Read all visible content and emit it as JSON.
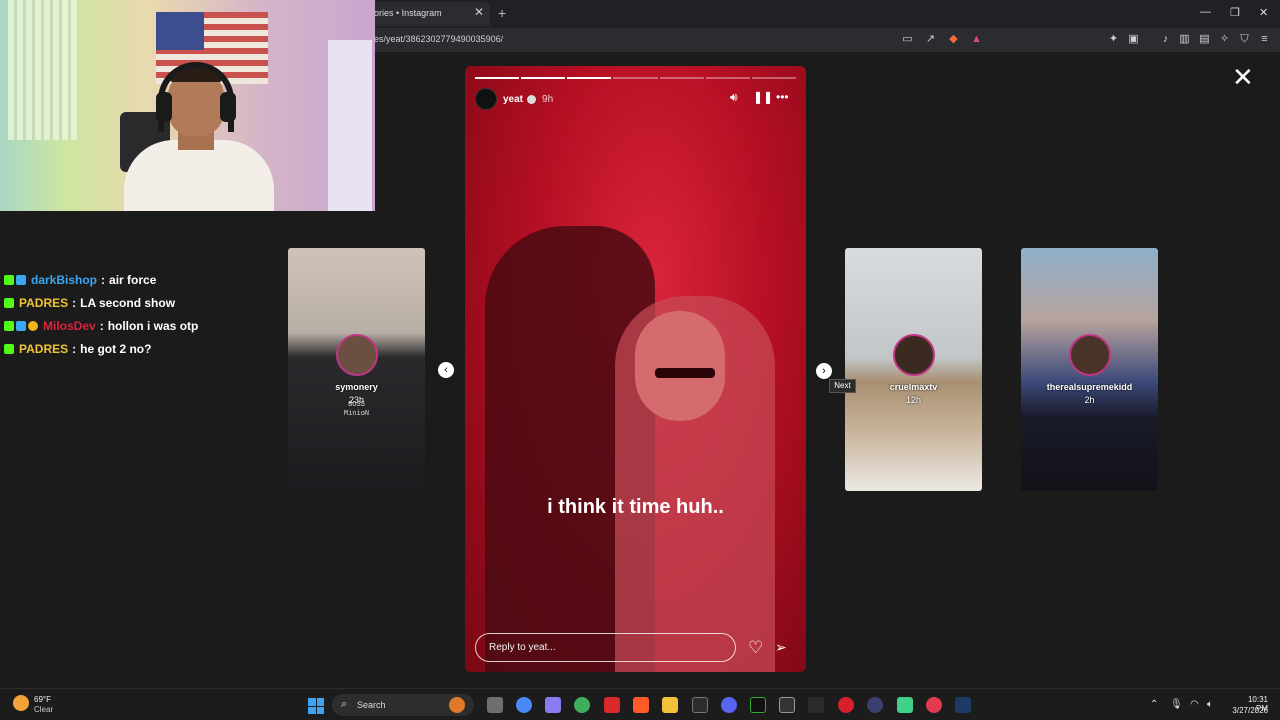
{
  "browser": {
    "tab_title": "ories • Instagram",
    "url": "ies/yeat/3862302779490035906/"
  },
  "chat": [
    {
      "user": "darkBishop",
      "message": "air force",
      "color": "#3aa7f0"
    },
    {
      "user": "PADRES",
      "message": "LA second show",
      "color": "#f1c232"
    },
    {
      "user": "MilosDev",
      "message": "hollon i was otp",
      "color": "#d9243c"
    },
    {
      "user": "PADRES",
      "message": "he got 2 no?",
      "color": "#f1c232"
    }
  ],
  "stories": {
    "prev_card": {
      "name": "symonery",
      "time": "23h",
      "extra_line1": "BOSS",
      "extra_line2": "MinioN"
    },
    "next_card": {
      "name": "cruelmaxtv",
      "time": "12h"
    },
    "next_card_2": {
      "name": "therealsupremekidd",
      "time": "2h"
    }
  },
  "main_story": {
    "username": "yeat",
    "time": "9h",
    "caption": "i think it time huh..",
    "reply_placeholder": "Reply to yeat...",
    "segments_total": 7,
    "segments_done": 3
  },
  "tooltip": "Next",
  "taskbar": {
    "weather_temp": "69°F",
    "weather_cond": "Clear",
    "search_label": "Search",
    "time": "10:31 PM",
    "date": "3/27/2026"
  },
  "colors": {
    "story_red": "#b50f24",
    "accent_ring": "#c13584"
  }
}
